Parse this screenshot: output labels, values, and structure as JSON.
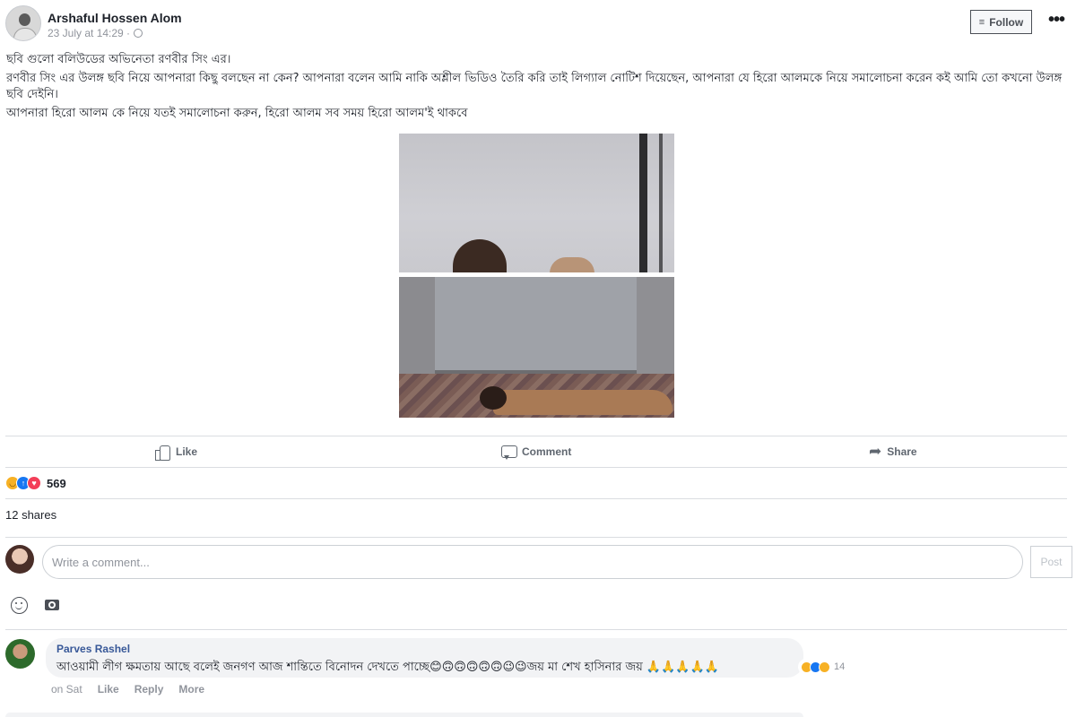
{
  "post": {
    "author": "Arshaful Hossen Alom",
    "timestamp": "23 July at 14:29 ·",
    "follow_label": "Follow",
    "more_label": "•••",
    "text": [
      "ছবি গুলো বলিউডের অভিনেতা রণবীর সিং এর।",
      "রণবীর সিং এর উলঙ্গ ছবি নিয়ে আপনারা কিছু বলছেন না কেন? আপনারা বলেন আমি নাকি অশ্লীল ভিডিও তৈরি করি তাই লিগ্যাল নোটিশ দিয়েছেন, আপনারা যে হিরো আলমকে নিয়ে সমালোচনা করেন কই আমি তো কখনো উলঙ্গ ছবি দেইনি।",
      "আপনারা হিরো আলম কে নিয়ে যতই সমালোচনা করুন, হিরো আলম সব সময় হিরো আলম'ই থাকবে"
    ]
  },
  "actions": {
    "like": "Like",
    "comment": "Comment",
    "share": "Share"
  },
  "reactions": {
    "count": "569",
    "types": [
      "haha-icon",
      "like-icon",
      "love-icon"
    ]
  },
  "shares": "12 shares",
  "comment_composer": {
    "placeholder": "Write a comment...",
    "post_label": "Post"
  },
  "comments": [
    {
      "author": "Parves Rashel",
      "text": "আওয়ামী লীগ ক্ষমতায় আছে বলেই জনগণ আজ শান্তিতে বিনোদন দেখতে পাচ্ছে😊🙃🙃🙃🙃🙃😉😉জয় মা শেখ হাসিনার জয় 🙏🙏🙏🙏🙏",
      "reaction_count": "14",
      "time": "on Sat",
      "like_label": "Like",
      "reply_label": "Reply",
      "more_label": "More"
    }
  ],
  "colors": {
    "link": "#385898",
    "muted": "#90949c",
    "bubble": "#f2f3f5",
    "divider": "#dadde1"
  }
}
